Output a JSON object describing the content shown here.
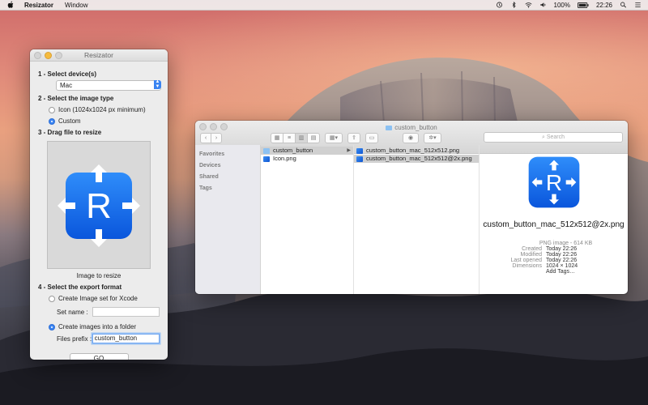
{
  "menubar": {
    "app_name": "Resizator",
    "menus": [
      "Window"
    ],
    "battery": "100%",
    "time": "22:26"
  },
  "resizator": {
    "title": "Resizator",
    "step1": "1 - Select device(s)",
    "device_value": "Mac",
    "step2": "2 - Select the image type",
    "type_icon": "Icon (1024x1024 px minimum)",
    "type_custom": "Custom",
    "step3": "3 - Drag file to resize",
    "drop_caption": "Image to resize",
    "step4": "4 - Select the export format",
    "export_xcode": "Create Image set for Xcode",
    "set_name_label": "Set name :",
    "set_name_value": "",
    "export_folder": "Create images into a folder",
    "prefix_label": "Files prefix :",
    "prefix_value": "custom_button",
    "go_label": "GO",
    "accent": "#3a84f2"
  },
  "finder": {
    "title": "custom_button",
    "search_placeholder": "Search",
    "sidebar": [
      "Favorites",
      "Devices",
      "Shared",
      "Tags"
    ],
    "col1": [
      {
        "name": "custom_button",
        "kind": "folder"
      },
      {
        "name": "Icon.png",
        "kind": "png"
      }
    ],
    "col2": [
      {
        "name": "custom_button_mac_512x512.png",
        "kind": "png"
      },
      {
        "name": "custom_button_mac_512x512@2x.png",
        "kind": "png"
      }
    ],
    "preview": {
      "name": "custom_button_mac_512x512@2x.png",
      "kind": "PNG image - 614 KB",
      "created_label": "Created",
      "created": "Today 22:26",
      "modified_label": "Modified",
      "modified": "Today 22:26",
      "opened_label": "Last opened",
      "opened": "Today 22:26",
      "dimensions_label": "Dimensions",
      "dimensions": "1024 × 1024",
      "add_tags": "Add Tags…"
    }
  }
}
